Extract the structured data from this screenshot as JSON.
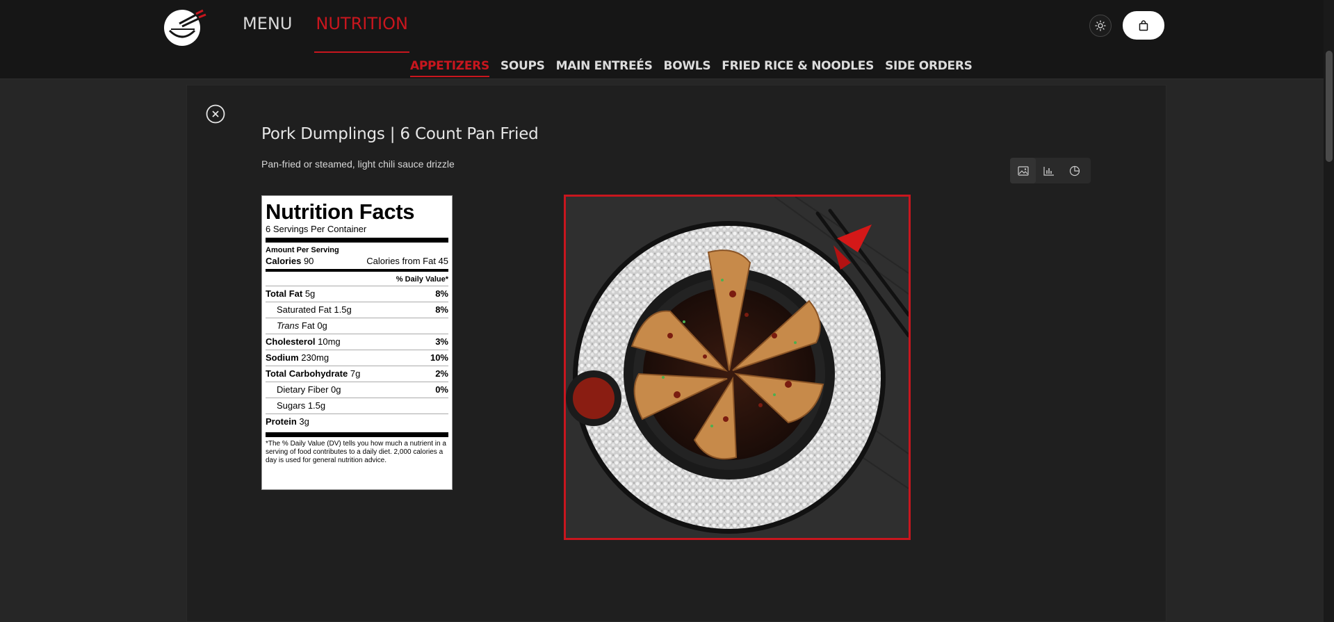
{
  "header": {
    "nav": [
      "MENU",
      "NUTRITION"
    ],
    "active_nav": "NUTRITION",
    "categories": [
      "APPETIZERS",
      "SOUPS",
      "MAIN ENTREÉS",
      "BOWLS",
      "FRIED RICE & NOODLES",
      "SIDE ORDERS"
    ],
    "active_category": "APPETIZERS",
    "theme_icon": "sun-icon",
    "cart_icon": "shopping-bag-icon"
  },
  "item": {
    "title": "Pork Dumplings | 6 Count Pan Fried",
    "description": "Pan-fried or steamed, light chili sauce drizzle",
    "views": [
      "image-icon",
      "bar-chart-icon",
      "pie-chart-icon"
    ]
  },
  "nutrition": {
    "title": "Nutrition Facts",
    "servings": "6 Servings Per Container",
    "amount_per_serving": "Amount Per Serving",
    "calories_label": "Calories",
    "calories_value": "90",
    "calories_fat": "Calories from Fat 45",
    "dv_header": "% Daily Value*",
    "rows": [
      {
        "label": "Total Fat",
        "amount": "5g",
        "pct": "8%"
      },
      {
        "label": "Saturated Fat",
        "amount": "1.5g",
        "pct": "8%"
      },
      {
        "label": "Trans",
        "label_rest": "Fat",
        "amount": "0g",
        "pct": ""
      },
      {
        "label": "Cholesterol",
        "amount": "10mg",
        "pct": "3%"
      },
      {
        "label": "Sodium",
        "amount": "230mg",
        "pct": "10%"
      },
      {
        "label": "Total Carbohydrate",
        "amount": "7g",
        "pct": "2%"
      },
      {
        "label": "Dietary Fiber",
        "amount": "0g",
        "pct": "0%"
      },
      {
        "label": "Sugars",
        "amount": "1.5g",
        "pct": ""
      },
      {
        "label": "Protein",
        "amount": "3g",
        "pct": ""
      }
    ],
    "footnote": "*The % Daily Value (DV) tells you how much a nutrient in a serving of food contributes to a daily diet. 2,000 calories a day is used for general nutrition advice."
  },
  "colors": {
    "accent": "#c8161e",
    "background": "#262626",
    "header": "#161616"
  }
}
